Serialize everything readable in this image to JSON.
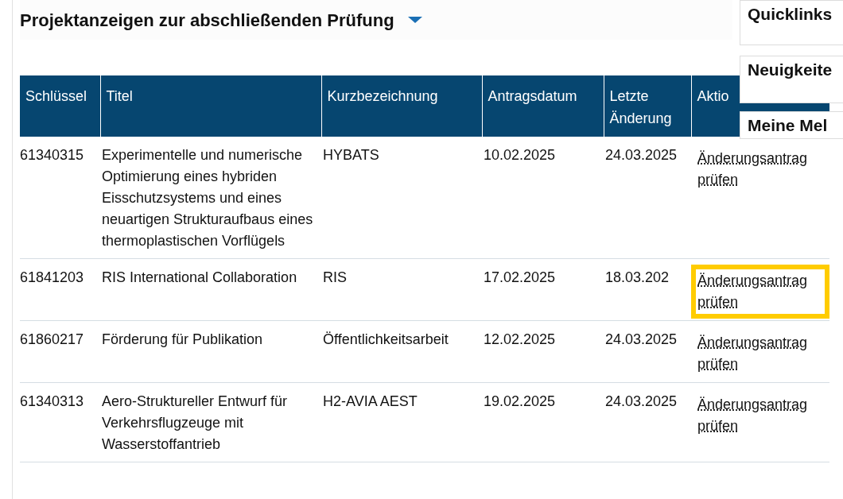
{
  "section": {
    "title": "Projektanzeigen zur abschließenden Prüfung",
    "expanded": true
  },
  "table": {
    "columns": [
      "Schlüssel",
      "Titel",
      "Kurzbezeichnung",
      "Antragsdatum",
      "Letzte Änderung",
      "Aktio"
    ],
    "rows": [
      {
        "key": "61340315",
        "title": "Experimentelle und numerische Optimierung eines hybriden Eisschutzsystems und eines neuartigen Strukturaufbaus eines thermoplastischen Vorflügels",
        "short": "HYBATS",
        "applied": "10.02.2025",
        "changed": "24.03.2025",
        "action": "Änderungsantrag prüfen",
        "focused": false
      },
      {
        "key": "61841203",
        "title": "RIS International Collaboration",
        "short": "RIS",
        "applied": "17.02.2025",
        "changed": "18.03.202",
        "action": "Änderungsantrag prüfen",
        "focused": true
      },
      {
        "key": "61860217",
        "title": "Förderung für Publikation",
        "short": "Öffentlichkeitsarbeit",
        "applied": "12.02.2025",
        "changed": "24.03.2025",
        "action": "Änderungsantrag prüfen",
        "focused": false
      },
      {
        "key": "61340313",
        "title": "Aero-Struktureller Entwurf für Verkehrsflugzeuge mit Wasserstoffantrieb",
        "short": "H2-AVIA AEST",
        "applied": "19.02.2025",
        "changed": "24.03.2025",
        "action": "Änderungsantrag prüfen",
        "focused": false
      }
    ]
  },
  "panels": [
    "Quicklinks",
    "Neuigkeite",
    "Meine Mel"
  ]
}
